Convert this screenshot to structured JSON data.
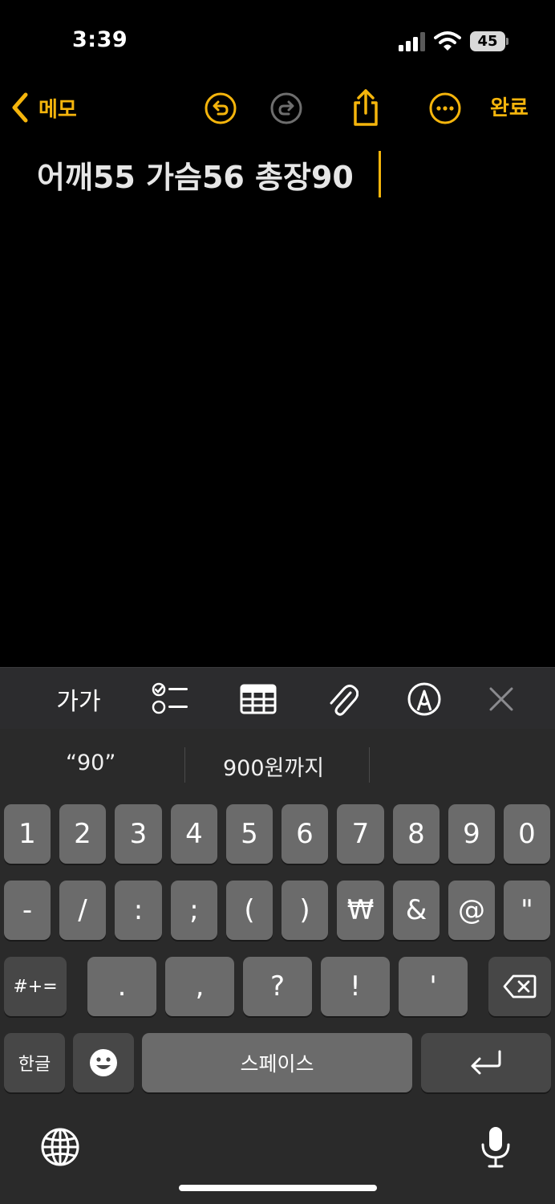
{
  "status_bar": {
    "time": "3:39",
    "battery": "45"
  },
  "nav": {
    "back_label": "메모",
    "done_label": "완료"
  },
  "note": {
    "text": "어깨55 가슴56 총장90"
  },
  "toolbar": {
    "format_label": "가가"
  },
  "suggestions": [
    "“90”",
    "900원까지"
  ],
  "keyboard": {
    "row1": [
      "1",
      "2",
      "3",
      "4",
      "5",
      "6",
      "7",
      "8",
      "9",
      "0"
    ],
    "row2": [
      "-",
      "/",
      ":",
      ";",
      "(",
      ")",
      "₩",
      "&",
      "@",
      "\""
    ],
    "row3_mode": "#+=",
    "row3": [
      ".",
      ",",
      "?",
      "!",
      "'"
    ],
    "lang": "한글",
    "space": "스페이스"
  },
  "colors": {
    "accent": "#f5b50c",
    "key": "#6b6b6b",
    "key_dark": "#474747",
    "keyboard_bg": "#2a2a2a"
  }
}
